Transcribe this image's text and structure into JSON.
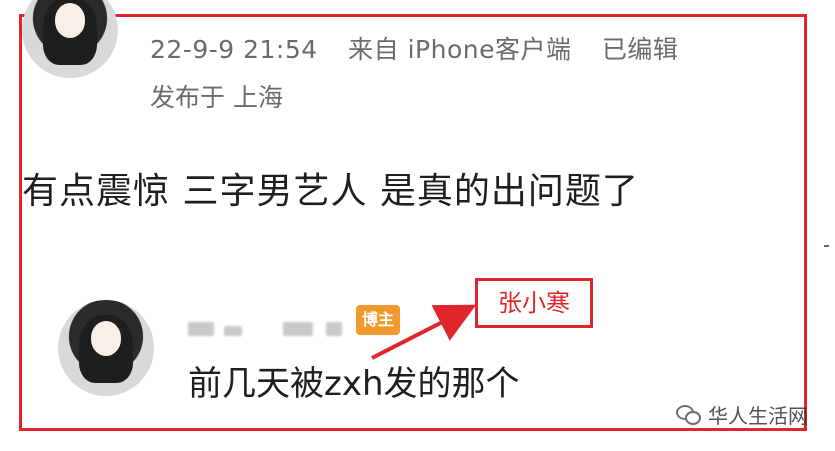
{
  "post": {
    "meta": {
      "datetime": "22-9-9 21:54",
      "source": "来自 iPhone客户端",
      "edited": "已编辑"
    },
    "location": "发布于 上海",
    "text": "有点震惊 三字男艺人 是真的出问题了"
  },
  "reply": {
    "badge": "博主",
    "text": "前几天被zxh发的那个"
  },
  "annotation": {
    "label": "张小寒",
    "color": "#e0262a"
  },
  "watermark": {
    "icon": "wechat-icon",
    "text": "华人生活网"
  }
}
